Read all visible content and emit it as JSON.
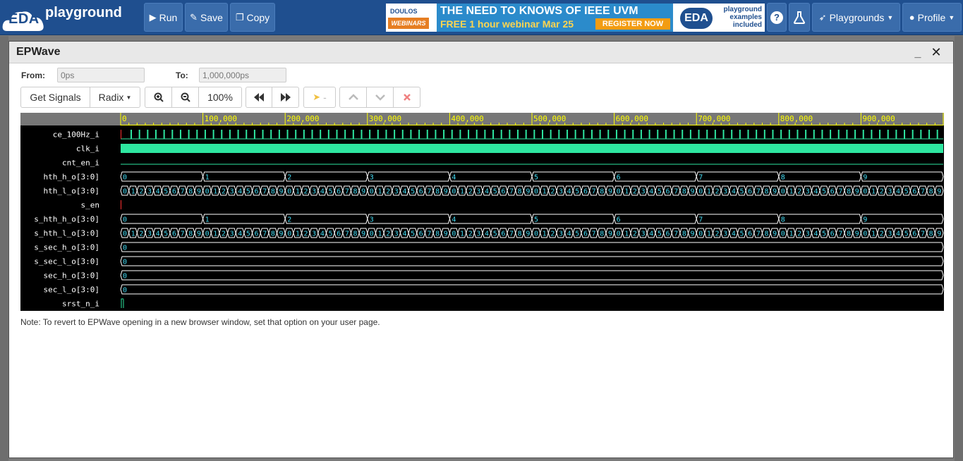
{
  "nav": {
    "logo_eda": "EDA",
    "logo_text": "playground",
    "run_label": "Run",
    "save_label": "Save",
    "copy_label": "Copy",
    "playgrounds_label": "Playgrounds",
    "profile_label": "Profile"
  },
  "ad": {
    "doulos": "DOULOS",
    "webinars": "WEBINARS",
    "line1": "THE NEED TO KNOWS OF IEEE UVM",
    "line2": "FREE 1 hour webinar Mar 25",
    "register": "REGISTER NOW",
    "eda": "EDA",
    "eda_text": "playground examples included"
  },
  "modal": {
    "title": "EPWave",
    "minimize": "_",
    "close": "✕",
    "from_label": "From:",
    "from_value": "0ps",
    "to_label": "To:",
    "to_value": "1,000,000ps",
    "get_signals": "Get Signals",
    "radix": "Radix",
    "zoom_level": "100%",
    "dash": "-",
    "note": "Note: To revert to EPWave opening in a new browser window, set that option on your user page."
  },
  "ruler": {
    "labels": [
      "0",
      "100,000",
      "200,000",
      "300,000",
      "400,000",
      "500,000",
      "600,000",
      "700,000",
      "800,000",
      "900,000"
    ],
    "range": [
      0,
      1000000
    ]
  },
  "signals": [
    {
      "name": "ce_100Hz_i",
      "kind": "pulse",
      "count": 100
    },
    {
      "name": "clk_i",
      "kind": "clock"
    },
    {
      "name": "cnt_en_i",
      "kind": "high"
    },
    {
      "name": "hth_h_o[3:0]",
      "kind": "bus",
      "segments": 10,
      "start": 0,
      "mod": 10
    },
    {
      "name": "hth_l_o[3:0]",
      "kind": "bus",
      "segments": 100,
      "start": 0,
      "mod": 10
    },
    {
      "name": "s_en",
      "kind": "low-red"
    },
    {
      "name": "s_hth_h_o[3:0]",
      "kind": "bus",
      "segments": 10,
      "start": 0,
      "mod": 10
    },
    {
      "name": "s_hth_l_o[3:0]",
      "kind": "bus",
      "segments": 100,
      "start": 0,
      "mod": 10
    },
    {
      "name": "s_sec_h_o[3:0]",
      "kind": "bus",
      "segments": 1,
      "start": 0,
      "mod": 10
    },
    {
      "name": "s_sec_l_o[3:0]",
      "kind": "bus",
      "segments": 1,
      "start": 0,
      "mod": 10
    },
    {
      "name": "sec_h_o[3:0]",
      "kind": "bus",
      "segments": 1,
      "start": 0,
      "mod": 10
    },
    {
      "name": "sec_l_o[3:0]",
      "kind": "bus",
      "segments": 1,
      "start": 0,
      "mod": 10
    },
    {
      "name": "srst_n_i",
      "kind": "rise"
    }
  ],
  "colors": {
    "nav_bg": "#1f4f8f",
    "wave_green": "#2ee6a0",
    "bus_text": "#41d8f0",
    "ruler_text": "#ffff00",
    "red": "#ff3030"
  }
}
